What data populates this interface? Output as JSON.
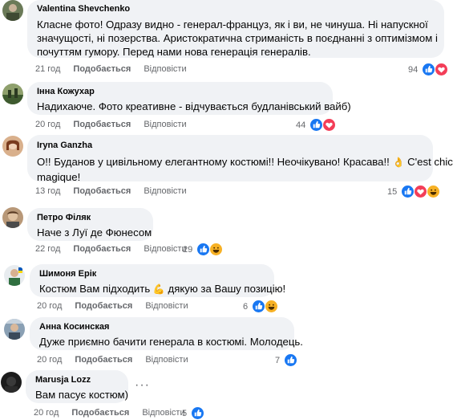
{
  "comments": [
    {
      "author": "Valentina Shevchenko",
      "lines": [
        "Класне фото! Одразу видно - генерал-француз, як і ви, не чинуша. Ні напускної",
        "значущості, ні позерства. Аристократична стриманість в поєднанні з оптимізмом і",
        "почуттям гумору. Перед нами нова генерація генералів."
      ],
      "time": "21 год",
      "like_label": "Подобається",
      "reply_label": "Відповісти",
      "reaction_count": "94",
      "reactions": [
        "like",
        "love"
      ]
    },
    {
      "author": "Інна Кожухар",
      "lines": [
        "Надихаюче. Фото креативне - відчувається будланівський вайб)"
      ],
      "time": "20 год",
      "like_label": "Подобається",
      "reply_label": "Відповісти",
      "reaction_count": "44",
      "reactions": [
        "like",
        "love"
      ]
    },
    {
      "author": "Iryna Ganzha",
      "lines": [
        "О!! Буданов у цивільному елегантному костюмі!! Неочікувано! Красава!!",
        "magique!"
      ],
      "line_suffix": " C'est chic",
      "time": "13 год",
      "like_label": "Подобається",
      "reply_label": "Відповісти",
      "reaction_count": "15",
      "reactions": [
        "like",
        "love",
        "haha"
      ]
    },
    {
      "author": "Петро Філяк",
      "lines": [
        "Наче з Луї де Фюнесом"
      ],
      "time": "22 год",
      "like_label": "Подобається",
      "reply_label": "Відповісти",
      "reaction_count": "29",
      "reactions": [
        "like",
        "haha"
      ]
    },
    {
      "author": "Шимоня Ерік",
      "lines": [
        "Костюм Вам підходить",
        "дякую за Вашу позицію!"
      ],
      "time": "20 год",
      "like_label": "Подобається",
      "reply_label": "Відповісти",
      "reaction_count": "6",
      "reactions": [
        "like",
        "haha"
      ]
    },
    {
      "author": "Анна Косинская",
      "lines": [
        "Дуже приємно бачити генерала в костюмі. Молодець."
      ],
      "time": "20 год",
      "like_label": "Подобається",
      "reply_label": "Відповісти",
      "reaction_count": "7",
      "reactions": [
        "like"
      ]
    },
    {
      "author": "Marusja Lozz",
      "lines": [
        "Вам пасує костюм)"
      ],
      "time": "20 год",
      "like_label": "Подобається",
      "reply_label": "Відповісти",
      "reaction_count": "5",
      "reactions": [
        "like"
      ]
    }
  ],
  "colors": {
    "like": "#1877f2",
    "love": "#f33e58",
    "haha": "#f7b125",
    "bubble": "#f0f2f5",
    "meta": "#65676b"
  }
}
